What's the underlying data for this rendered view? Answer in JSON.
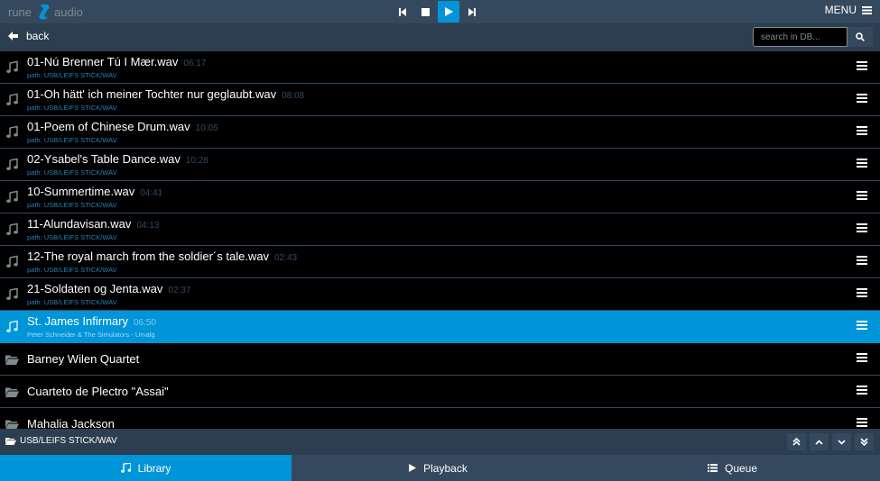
{
  "app": {
    "brand_left": "rune",
    "brand_right": "audio",
    "menu_label": "MENU",
    "accent": "#0095d8"
  },
  "transport": {
    "icons": [
      "previous-icon",
      "stop-icon",
      "play-icon",
      "next-icon"
    ],
    "active": "play"
  },
  "nav": {
    "back_label": "back",
    "search_placeholder": "search in DB..."
  },
  "list": {
    "rows": [
      {
        "type": "track",
        "title": "01-Nú Brenner Tú I Mær.wav",
        "duration": "06:17",
        "sub": "path: USB/LEIFS STICK/WAV"
      },
      {
        "type": "track",
        "title": "01-Oh hätt' ich meiner Tochter nur geglaubt.wav",
        "duration": "08:08",
        "sub": "path: USB/LEIFS STICK/WAV"
      },
      {
        "type": "track",
        "title": "01-Poem of Chinese Drum.wav",
        "duration": "10:05",
        "sub": "path: USB/LEIFS STICK/WAV"
      },
      {
        "type": "track",
        "title": "02-Ysabel's Table Dance.wav",
        "duration": "10:28",
        "sub": "path: USB/LEIFS STICK/WAV"
      },
      {
        "type": "track",
        "title": "10-Summertime.wav",
        "duration": "04:41",
        "sub": "path: USB/LEIFS STICK/WAV"
      },
      {
        "type": "track",
        "title": "11-Alundavisan.wav",
        "duration": "04:13",
        "sub": "path: USB/LEIFS STICK/WAV"
      },
      {
        "type": "track",
        "title": "12-The royal march from the soldier´s tale.wav",
        "duration": "02:43",
        "sub": "path: USB/LEIFS STICK/WAV"
      },
      {
        "type": "track",
        "title": "21-Soldaten og Jenta.wav",
        "duration": "02:37",
        "sub": "path: USB/LEIFS STICK/WAV"
      },
      {
        "type": "track",
        "title": "St. James Infirmary",
        "duration": "06:50",
        "sub": "Peter Schneider & The Simulators - Urvalg",
        "selected": true
      },
      {
        "type": "dir",
        "title": "Barney Wilen Quartet"
      },
      {
        "type": "dir",
        "title": "Cuarteto de Plectro \"Assai\""
      },
      {
        "type": "dir",
        "title": "Mahalia Jackson"
      }
    ]
  },
  "pathbar": {
    "current_path": "USB/LEIFS STICK/WAV",
    "buttons": [
      "double-up-icon",
      "up-icon",
      "down-icon",
      "double-down-icon"
    ]
  },
  "tabs": {
    "library": "Library",
    "playback": "Playback",
    "queue": "Queue",
    "active": "library"
  }
}
